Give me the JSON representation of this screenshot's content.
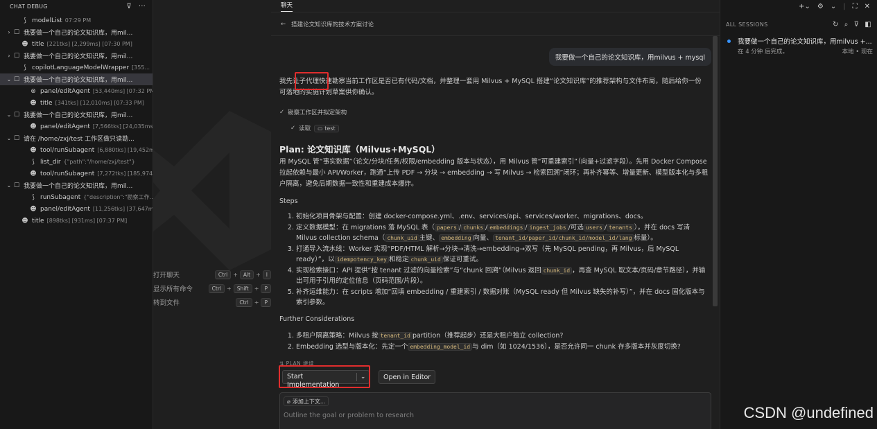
{
  "left_panel": {
    "title": "CHAT DEBUG",
    "items": [
      {
        "chevron": "",
        "icon": "⟆",
        "icon_name": "debug-step-icon",
        "label": "modelList",
        "meta": "07:29 PM",
        "indent": 1
      },
      {
        "chevron": "›",
        "icon": "☐",
        "icon_name": "chat-bubble-icon",
        "label": "我要做一个自己的论文知识库，用mil...",
        "meta": "",
        "indent": 0
      },
      {
        "chevron": "",
        "icon": "☻",
        "icon_name": "copilot-icon",
        "label": "title",
        "meta": "[221tks] [2,299ms] [07:30 PM]",
        "indent": 1
      },
      {
        "chevron": "›",
        "icon": "☐",
        "icon_name": "chat-bubble-icon",
        "label": "我要做一个自己的论文知识库，用mil...",
        "meta": "",
        "indent": 0
      },
      {
        "chevron": "",
        "icon": "⟆",
        "icon_name": "debug-step-icon",
        "label": "copilotLanguageModelWrapper",
        "meta": "[355...",
        "indent": 1
      },
      {
        "chevron": "⌄",
        "icon": "☐",
        "icon_name": "chat-bubble-icon",
        "label": "我要做一个自己的论文知识库，用mil...",
        "meta": "",
        "indent": 0,
        "selected": true
      },
      {
        "chevron": "",
        "icon": "⊗",
        "icon_name": "error-circle-icon",
        "label": "panel/editAgent",
        "meta": "[53,440ms] [07:32 PM]",
        "indent": 2
      },
      {
        "chevron": "",
        "icon": "☻",
        "icon_name": "copilot-icon",
        "label": "title",
        "meta": "[341tks] [12,010ms] [07:33 PM]",
        "indent": 2
      },
      {
        "chevron": "⌄",
        "icon": "☐",
        "icon_name": "chat-bubble-icon",
        "label": "我要做一个自己的论文知识库，用mil...",
        "meta": "",
        "indent": 0
      },
      {
        "chevron": "",
        "icon": "☻",
        "icon_name": "copilot-icon",
        "label": "panel/editAgent",
        "meta": "[7,566tks] [24,035ms]...",
        "indent": 2
      },
      {
        "chevron": "⌄",
        "icon": "☐",
        "icon_name": "chat-bubble-icon",
        "label": "请在 /home/zxj/test 工作区做只读勘...",
        "meta": "",
        "indent": 0
      },
      {
        "chevron": "",
        "icon": "☻",
        "icon_name": "copilot-icon",
        "label": "tool/runSubagent",
        "meta": "[6,880tks] [19,452m...",
        "indent": 2
      },
      {
        "chevron": "",
        "icon": "⟆",
        "icon_name": "debug-step-icon",
        "label": "list_dir",
        "meta": "{\"path\":\"/home/zxj/test\"}",
        "indent": 2
      },
      {
        "chevron": "",
        "icon": "☻",
        "icon_name": "copilot-icon",
        "label": "tool/runSubagent",
        "meta": "[7,272tks] [185,974...",
        "indent": 2
      },
      {
        "chevron": "⌄",
        "icon": "☐",
        "icon_name": "chat-bubble-icon",
        "label": "我要做一个自己的论文知识库，用mil...",
        "meta": "",
        "indent": 0
      },
      {
        "chevron": "",
        "icon": "⟆",
        "icon_name": "debug-step-icon",
        "label": "runSubagent",
        "meta": "{\"description\":\"勘察工作...",
        "indent": 2
      },
      {
        "chevron": "",
        "icon": "☻",
        "icon_name": "copilot-icon",
        "label": "panel/editAgent",
        "meta": "[11,256tks] [37,647m...",
        "indent": 2
      },
      {
        "chevron": "",
        "icon": "☻",
        "icon_name": "copilot-icon",
        "label": "title",
        "meta": "[898tks] [931ms] [07:37 PM]",
        "indent": 1
      }
    ]
  },
  "shortcuts": [
    {
      "label": "打开聊天",
      "keys": [
        "Ctrl",
        "Alt",
        "I"
      ]
    },
    {
      "label": "显示所有命令",
      "keys": [
        "Ctrl",
        "Shift",
        "P"
      ]
    },
    {
      "label": "转到文件",
      "keys": [
        "Ctrl",
        "P"
      ]
    }
  ],
  "chat": {
    "tab": "聊天",
    "back_title": "搭建论文知识库的技术方案讨论",
    "user_message": "我要做一个自己的论文知识库，用milvus + mysql",
    "intro": "我先让子代理快速勘察当前工作区是否已有代码/文档，并整理一套用 Milvus + MySQL 搭建“论文知识库”的推荐架构与文件布局，随后给你一份可落地的实施计划草案供你确认。",
    "task_done": "勘察工作区并拟定架构",
    "read_label": "读取",
    "read_chip": "test",
    "plan_title": "Plan: 论文知识库（Milvus+MySQL）",
    "plan_desc": "用 MySQL 管“事实数据”（论文/分块/任务/权限/embedding 版本与状态），用 Milvus 管“可重建索引”（向量+过滤字段）。先用 Docker Compose 拉起依赖与最小 API/Worker，跑通“上传 PDF → 分块 → embedding → 写 Milvus → 检索回溯”闭环；再补齐幂等、增量更新、模型版本化与多租户隔离，避免后期数据一致性和重建成本爆炸。",
    "steps_title": "Steps",
    "steps": {
      "s1": "初始化项目骨架与配置：创建 docker-compose.yml、.env、services/api、services/worker、migrations、docs。",
      "s2_a": "定义数据模型：在 migrations 落 MySQL 表（",
      "s2_c1": "papers",
      "s2_c2": "chunks",
      "s2_c3": "embeddings",
      "s2_c4": "ingest_jobs",
      "s2_b": "/可选",
      "s2_c5": "users",
      "s2_c6": "tenants",
      "s2_d": "），并在 docs 写清 Milvus collection schema（",
      "s2_c7": "chunk_uid",
      "s2_e": "主键、",
      "s2_c8": "embedding",
      "s2_f": "向量、",
      "s2_c9": "tenant_id/paper_id/chunk_id/model_id/lang",
      "s2_g": "标量）。",
      "s3_a": "打通导入流水线：Worker 实现“PDF/HTML 解析→分块→清洗→embedding→双写（先 MySQL pending，再 Milvus，后 MySQL ready）”，以",
      "s3_c1": "idempotency_key",
      "s3_b": "和稳定",
      "s3_c2": "chunk_uid",
      "s3_c": "保证可重试。",
      "s4_a": "实现检索接口：API 提供“按 tenant 过滤的向量检索”与“chunk 回溯”（Milvus 返回",
      "s4_c1": "chunk_id",
      "s4_b": "，再查 MySQL 取文本/页码/章节路径），并输出可用于引用的定位信息（页码范围/片段）。",
      "s5": "补齐运维能力：在 scripts 增加“回填 embedding / 重建索引 / 数据对账（MySQL ready 但 Milvus 缺失的补写）”，并在 docs 固化版本与索引参数。"
    },
    "further_title": "Further Considerations",
    "further": {
      "f1_a": "多租户隔离策略：Milvus 按",
      "f1_c": "tenant_id",
      "f1_b": "partition（推荐起步）还是大租户独立 collection?",
      "f2_a": "Embedding 选型与版本化：先定一个",
      "f2_c": "embedding_model_id",
      "f2_b": "与 dim（如 1024/1536），是否允许同一 chunk 存多版本并灰度切换?"
    },
    "plan_label": "⇅ PLAN 继续",
    "start_btn": "Start Implementation",
    "dropdown": "⌄",
    "open_editor": "Open in Editor",
    "add_context": "添加上下文...",
    "input_placeholder": "Outline the goal or problem to research"
  },
  "sessions": {
    "title": "ALL SESSIONS",
    "items": [
      {
        "title": "我要做一个自己的论文知识库，用milvus +...",
        "status": "在 4 分钟 后完成。",
        "meta": "本地 • 现在"
      }
    ]
  },
  "watermark": "CSDN @undefined",
  "colors": {
    "accent": "#3794ff",
    "highlight": "#e02d2d",
    "background": "#1f1f1f"
  }
}
